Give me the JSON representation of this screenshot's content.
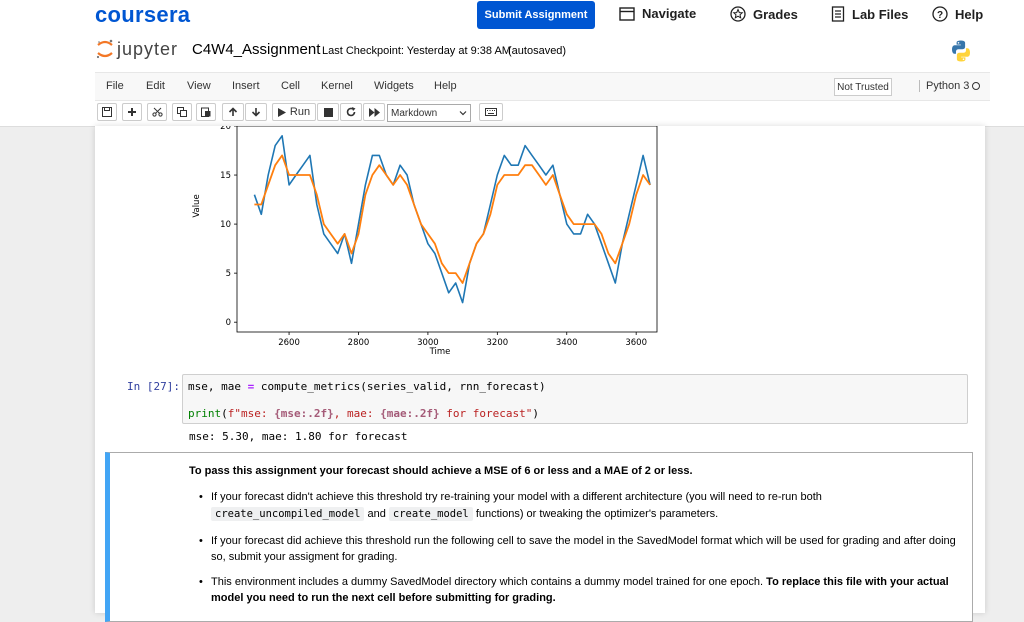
{
  "coursera": {
    "logo": "coursera",
    "submit_label": "Submit Assignment",
    "nav": [
      {
        "label": "Navigate",
        "icon": "navigate-icon"
      },
      {
        "label": "Grades",
        "icon": "grades-icon"
      },
      {
        "label": "Lab Files",
        "icon": "lab-files-icon"
      },
      {
        "label": "Help",
        "icon": "help-icon"
      }
    ],
    "brand_color": "#0056d2"
  },
  "jupyter": {
    "logo_text": "jupyter",
    "notebook_name": "C4W4_Assignment",
    "checkpoint": "Last Checkpoint: Yesterday at 9:38 AM",
    "autosave": "(autosaved)",
    "menu": [
      "File",
      "Edit",
      "View",
      "Insert",
      "Cell",
      "Kernel",
      "Widgets",
      "Help"
    ],
    "trust": "Not Trusted",
    "kernel": "Python 3",
    "run_label": "Run",
    "cell_type": "Markdown"
  },
  "chart_data": {
    "type": "line",
    "xlabel": "Time",
    "ylabel": "Value",
    "xticks": [
      2600,
      2800,
      3000,
      3200,
      3400,
      3600
    ],
    "yticks": [
      0,
      5,
      10,
      15,
      20
    ],
    "xlim": [
      2450,
      3660
    ],
    "ylim": [
      -1,
      20
    ],
    "series": [
      {
        "color": "#1f77b4",
        "x": [
          2500,
          2520,
          2540,
          2560,
          2580,
          2600,
          2620,
          2640,
          2660,
          2680,
          2700,
          2720,
          2740,
          2760,
          2780,
          2800,
          2820,
          2840,
          2860,
          2880,
          2900,
          2920,
          2940,
          2960,
          2980,
          3000,
          3020,
          3040,
          3060,
          3080,
          3100,
          3120,
          3140,
          3160,
          3180,
          3200,
          3220,
          3240,
          3260,
          3280,
          3300,
          3320,
          3340,
          3360,
          3380,
          3400,
          3420,
          3440,
          3460,
          3480,
          3500,
          3520,
          3540,
          3560,
          3580,
          3600,
          3620,
          3640
        ],
        "y": [
          13,
          11,
          15,
          18,
          19,
          14,
          15,
          16,
          17,
          12,
          9,
          8,
          7,
          9,
          6,
          10,
          14,
          17,
          17,
          15,
          14,
          16,
          15,
          12,
          10,
          8,
          7,
          5,
          3,
          4,
          2,
          6,
          8,
          9,
          12,
          15,
          17,
          16,
          16,
          18,
          17,
          16,
          15,
          16,
          13,
          10,
          9,
          9,
          11,
          10,
          8,
          6,
          4,
          8,
          11,
          14,
          17,
          14
        ]
      },
      {
        "color": "#ff7f0e",
        "x": [
          2500,
          2520,
          2540,
          2560,
          2580,
          2600,
          2620,
          2640,
          2660,
          2680,
          2700,
          2720,
          2740,
          2760,
          2780,
          2800,
          2820,
          2840,
          2860,
          2880,
          2900,
          2920,
          2940,
          2960,
          2980,
          3000,
          3020,
          3040,
          3060,
          3080,
          3100,
          3120,
          3140,
          3160,
          3180,
          3200,
          3220,
          3240,
          3260,
          3280,
          3300,
          3320,
          3340,
          3360,
          3380,
          3400,
          3420,
          3440,
          3460,
          3480,
          3500,
          3520,
          3540,
          3560,
          3580,
          3600,
          3620,
          3640
        ],
        "y": [
          12,
          12,
          14,
          16,
          17,
          15,
          15,
          15,
          15,
          13,
          10,
          9,
          8,
          9,
          7,
          9,
          13,
          15,
          16,
          15,
          14,
          15,
          14,
          12,
          10,
          9,
          8,
          6,
          5,
          5,
          4,
          6,
          8,
          9,
          11,
          14,
          15,
          15,
          15,
          16,
          16,
          15,
          14,
          15,
          13,
          11,
          10,
          10,
          10,
          10,
          9,
          7,
          6,
          8,
          10,
          13,
          15,
          14
        ]
      }
    ]
  },
  "code_cell": {
    "prompt": "In [27]:",
    "line1": {
      "vars": "mse, mae",
      "eq": "=",
      "call": " compute_metrics(series_valid, rnn_forecast)"
    },
    "line2": {
      "fn": "print",
      "open": "(",
      "s1": "f\"mse: ",
      "f1": "{mse:.2f}",
      "s2": ", mae: ",
      "f2": "{mae:.2f}",
      "s3": " for forecast\"",
      "close": ")"
    },
    "output": "mse: 5.30, mae: 1.80 for forecast"
  },
  "markdown": {
    "title": "To pass this assignment your forecast should achieve a MSE of 6 or less and a MAE of 2 or less.",
    "b1_line1": "If your forecast didn't achieve this threshold try re-training your model with a different architecture (you will need to re-run both",
    "b1_code1": "create_uncompiled_model",
    "b1_and": "and",
    "b1_code2": "create_model",
    "b1_tail": "functions) or tweaking the optimizer's parameters.",
    "b2_line1": "If your forecast did achieve this threshold run the following cell to save the model in the SavedModel format which will be used for grading and after doing",
    "b2_line2": "so, submit your assigment for grading.",
    "b3_line1": "This environment includes a dummy SavedModel directory which contains a dummy model trained for one epoch.",
    "b3_bold1": "To replace this file with your actual",
    "b3_bold2": "model you need to run the next cell before submitting for grading."
  }
}
